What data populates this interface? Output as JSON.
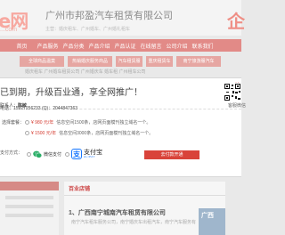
{
  "background": {
    "logo_text": "e网",
    "logo_sub": "...com",
    "company_name": "广州市邦盈汽车租赁有限公司",
    "company_sub": "主营：婚庆租车、广州婚车、广州婚礼租车",
    "corner_logo": "企",
    "nav": [
      "首页",
      "产品服务",
      "产品分类",
      "产品介绍",
      "产品认证",
      "在线留言",
      "公司介绍",
      "联系我们"
    ],
    "categories": [
      "全球商品温莫",
      "热销婚庆服务商品",
      "汽车租赁服",
      "重庆租赁车",
      "南宁旅游服汽车"
    ],
    "subcategories": "婚庆租车    广州婚车租赁公司    广州婚庆车    婚车租    广州租车公司",
    "card_header": "百业店铺",
    "card_name": "1、广西南宁城南汽车租赁有限公司",
    "card_desc": "南宁汽车租车服务公司，南宁婚庆车出租汽车，南宁汽车服务有",
    "card_thumb_text": "广西"
  },
  "modal": {
    "headline": "已到期，升级百业通，享全网推广！",
    "close_label": "×",
    "contact_label": "联系人：",
    "contact_name": "陈敏",
    "phone_line": "电话：15927256233    (Q)：2044847363",
    "qr_label": "客服微信",
    "choose_label": "选择套餐：",
    "packages": [
      {
        "price": "¥ 980 元/年",
        "desc": "信息空间1500条，店网页面模刊独立域名一个。"
      },
      {
        "price": "¥ 1500 元/年",
        "desc": "信息空间3000条，店网页面模刊独立域名一个。"
      }
    ],
    "pay_label": "支付方式：",
    "wechat_label": "微信支付",
    "alipay_label": "支付宝",
    "alipay_sub": "ALIPAY",
    "pay_button": "去付款开通"
  }
}
